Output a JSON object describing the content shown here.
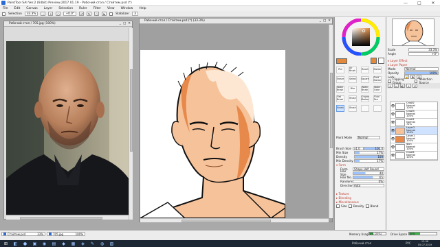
{
  "window": {
    "title": "PaintTool SAI Ver.2 (64bit) Preview.2017.01.19 - Рабочий стол / Стэйтем.psd (*)",
    "controls": [
      "—",
      "□",
      "✕"
    ]
  },
  "menu": [
    "File",
    "Edit",
    "Canvas",
    "Layer",
    "Selection",
    "Ruler",
    "Filter",
    "View",
    "Window",
    "Help"
  ],
  "toolbar": {
    "selection_label": "Selection",
    "zoom": "33.3%",
    "rotation": "+0.0°",
    "stabilizer_label": "Stabilizer",
    "stabilizer_value": "3"
  },
  "photo_window": {
    "title": "Рабочий стол / 705.jpg (100%)"
  },
  "canvas_window": {
    "title": "Рабочий стол / Стэйтем.psd (*) (33.3%)"
  },
  "navigator": {
    "scale_label": "Scale",
    "scale_value": "33.3%",
    "angle_label": "Angle",
    "angle_value": "+0°"
  },
  "layer_effect_label": "Layer Effect",
  "layer_paper_label": "Layer Paper",
  "layer_props": {
    "mode_label": "Mode",
    "mode_value": "Normal",
    "opacity_label": "Opacity",
    "opacity_value": "100%",
    "lock_label": "Lock",
    "clipping_label": "Clipping Group",
    "sel_source_label": "Selection Source"
  },
  "layers": [
    {
      "name": "Слой2",
      "mode": "Normal",
      "opacity": "100%",
      "selected": false
    },
    {
      "name": "Слой3",
      "mode": "Normal",
      "opacity": "100%",
      "selected": false
    },
    {
      "name": "Слой1",
      "mode": "Normal",
      "opacity": "72%",
      "selected": false
    },
    {
      "name": "Layer2",
      "mode": "Normal",
      "opacity": "100%",
      "selected": true
    },
    {
      "name": "Layer1",
      "mode": "Normal",
      "opacity": "100%",
      "selected": false
    },
    {
      "name": "Фон",
      "mode": "Normal",
      "opacity": "100%",
      "selected": false
    },
    {
      "name": "Слой4",
      "mode": "Normal",
      "opacity": "100%",
      "selected": false
    }
  ],
  "tools": [
    {
      "label": "Pen",
      "sel": false
    },
    {
      "label": "Air Brush",
      "sel": false
    },
    {
      "label": "Brush",
      "sel": false
    },
    {
      "label": "Marker",
      "sel": false
    },
    {
      "label": "Eraser",
      "sel": false
    },
    {
      "label": "Select",
      "sel": false
    },
    {
      "label": "Square",
      "sel": false
    },
    {
      "label": "Fluid Marker",
      "sel": false
    },
    {
      "label": "Water Brush",
      "sel": false
    },
    {
      "label": "Blur",
      "sel": false
    },
    {
      "label": "Water Brush",
      "sel": false
    },
    {
      "label": "Water Color",
      "sel": false
    },
    {
      "label": "Flat Brush",
      "sel": false
    },
    {
      "label": "Brush",
      "sel": false
    },
    {
      "label": "Crayon Marker",
      "sel": false
    },
    {
      "label": "Fluid Pen",
      "sel": false
    },
    {
      "label": "Brush",
      "sel": true
    },
    {
      "label": "Brush",
      "sel": false
    },
    {
      "label": "",
      "sel": false
    },
    {
      "label": "",
      "sel": false
    }
  ],
  "brush": {
    "paint_mode_label": "Paint Mode",
    "paint_mode_value": "Normal",
    "size_label": "Brush Size",
    "size_mult": "x1.0",
    "size_value": "102.0",
    "min_size_label": "Min Size",
    "min_size_value": "17%",
    "density_label": "Density",
    "density_value": "100",
    "min_density_label": "Min Density",
    "min_density_value": "17%",
    "blending_label": "Blending",
    "blending_value": "25",
    "form_section": "Form",
    "form_label": "Form",
    "form_value": "Shape Half Round",
    "hair_size_label": "Hair Size",
    "hair_size_value": "40",
    "hair_no_label": "Hair No.",
    "hair_no_value": "65",
    "random_label": "Randomize",
    "random_value": "0%",
    "direction_label": "Direction",
    "direction_value": "Auto",
    "texture_label": "Texture",
    "blending_sec": "Blending",
    "misc_label": "Miscellaneous",
    "opts": [
      "Size",
      "Density",
      "Blend"
    ]
  },
  "doc_tabs": [
    {
      "name": "Стэйтем.psd",
      "zoom": "33%"
    },
    {
      "name": "705.jpg",
      "zoom": "100%"
    }
  ],
  "status": {
    "memory_label": "Memory Usage",
    "memory_value": "4% (25%)",
    "memory_fill": 0.25,
    "drive_label": "Drive Space",
    "drive_value": "40%",
    "drive_fill": 0.4
  },
  "taskbar": {
    "desktop_label": "Рабочий стол",
    "lang": "РУС",
    "time": "13:38",
    "date": "05.07.2019"
  },
  "colors": {
    "skin_light": "#f6c29a",
    "skin_shadow": "#e7894a",
    "skin_highlight": "#fde7d3",
    "accent_orange": "#e2893b"
  }
}
